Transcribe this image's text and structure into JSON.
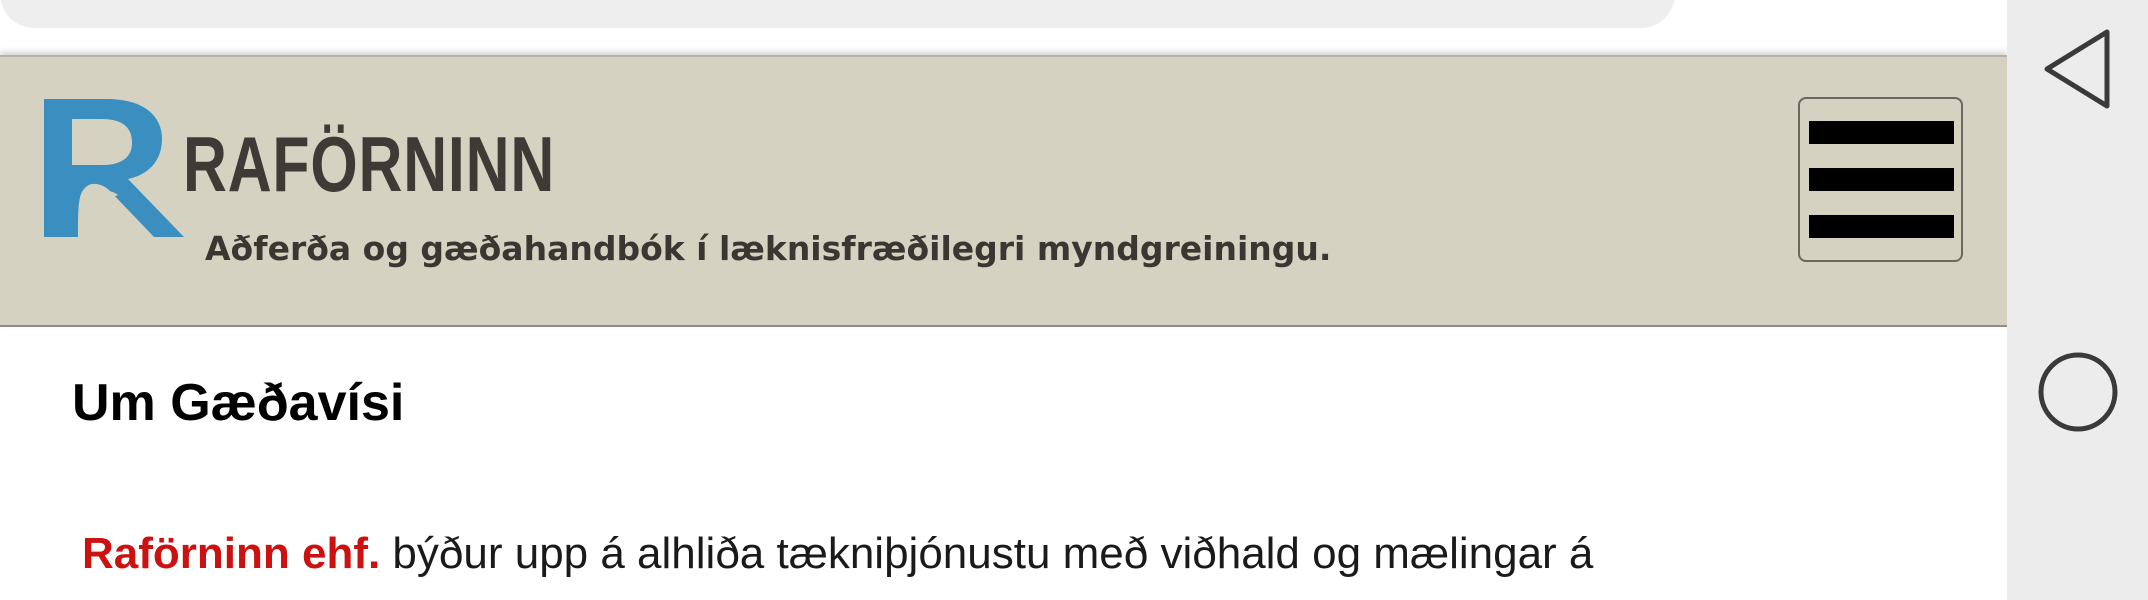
{
  "header": {
    "brand_name": "RAFÖRNINN",
    "tagline": "Aðferða og gæðahandbók í læknisfræðilegri myndgreiningu.",
    "menu_icon": "hamburger-menu-icon",
    "colors": {
      "background": "#d6d2c1",
      "logo_blue": "#3a8fc0",
      "brand_text": "#3f3a35"
    }
  },
  "main": {
    "title": "Um Gæðavísi",
    "intro": {
      "company": "Raförninn ehf.",
      "text": " býður upp á alhliða tækniþjónustu með viðhald og mælingar á"
    },
    "colors": {
      "company_name": "#cc1111"
    }
  },
  "system_nav": {
    "back_icon": "back-triangle-icon",
    "home_icon": "home-circle-icon"
  }
}
